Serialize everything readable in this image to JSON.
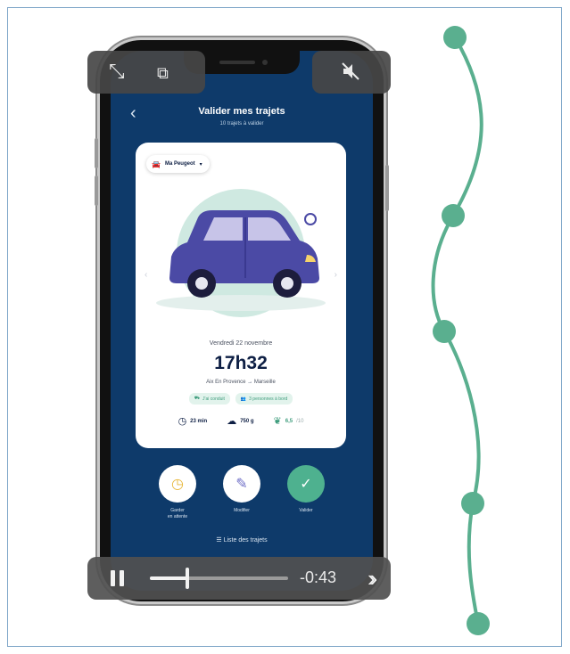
{
  "app": {
    "title": "Valider mes trajets",
    "subtitle": "10 trajets à valider",
    "back_icon": "chevron-left-icon"
  },
  "card": {
    "vehicle": "Ma Peugeot",
    "date": "Vendredi 22 novembre",
    "time": "17h32",
    "route_from": "Aix En Provence",
    "route_arrow": "→",
    "route_to": "Marseille",
    "chips": [
      {
        "icon": "car-icon",
        "label": "J'ai conduit"
      },
      {
        "icon": "people-icon",
        "label": "3 personnes à bord"
      }
    ],
    "stats": [
      {
        "icon": "clock-icon",
        "value": "23 min"
      },
      {
        "icon": "co2-icon",
        "value": "750 g"
      },
      {
        "icon": "leaf-icon",
        "value": "6,5",
        "unit": "/10"
      }
    ]
  },
  "actions": [
    {
      "label": "Garder\nen attente",
      "icon": "clock-icon"
    },
    {
      "label": "Modifier",
      "icon": "pencil-icon"
    },
    {
      "label": "Valider",
      "icon": "check-icon"
    }
  ],
  "trips_link": "Liste des trajets",
  "video": {
    "remaining": "-0:43",
    "progress": 0.27
  },
  "colors": {
    "screen_bg": "#0e3a6a",
    "accent_green": "#4eb18f",
    "car_purple": "#4b4aa5",
    "clock_yellow": "#e7b73a",
    "timeline_green": "#5aaf8f"
  }
}
